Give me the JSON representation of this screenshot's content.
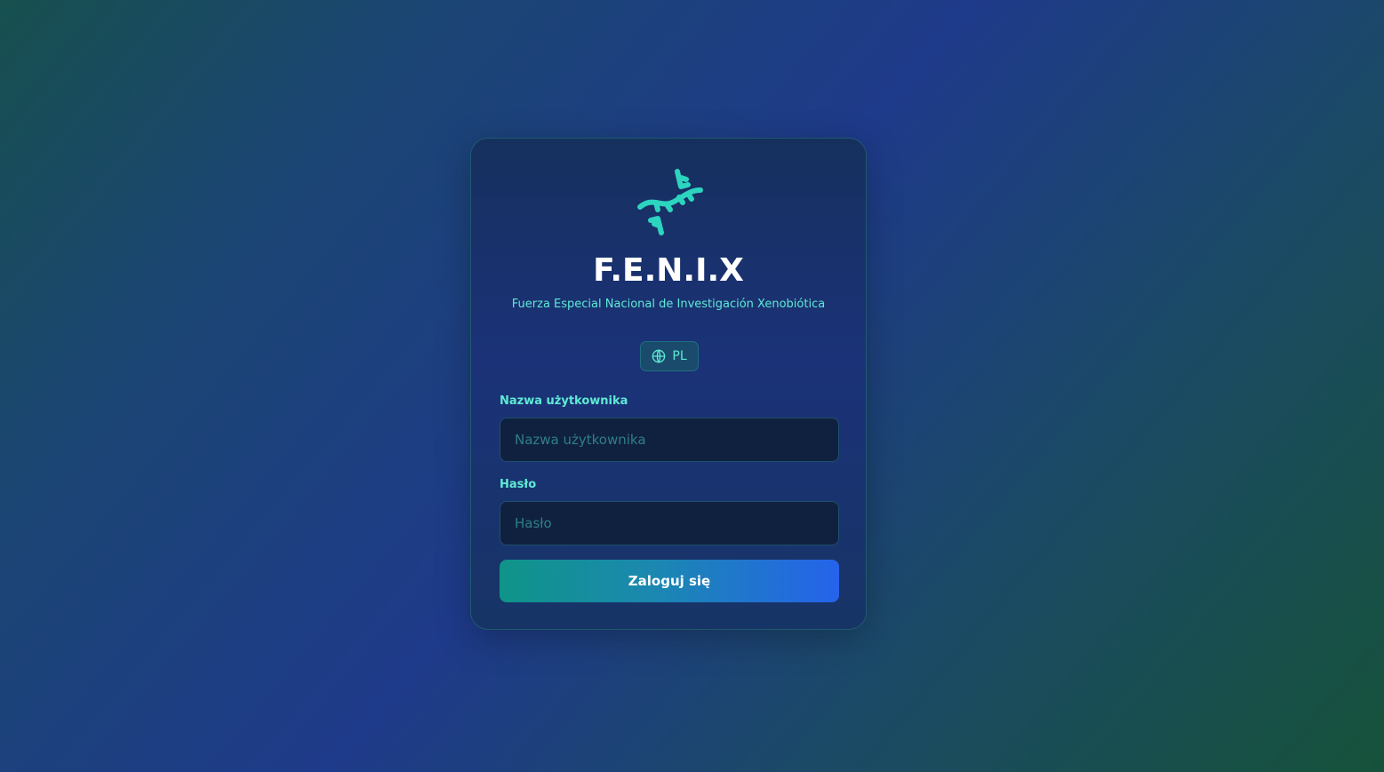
{
  "app": {
    "title": "F.E.N.I.X",
    "subtitle": "Fuerza Especial Nacional de Investigación Xenobiótica",
    "logo_icon": "dna-icon",
    "accent_color": "#2dd4bf"
  },
  "language": {
    "icon": "globe-icon",
    "label": "PL"
  },
  "form": {
    "username_label": "Nazwa użytkownika",
    "username_placeholder": "Nazwa użytkownika",
    "username_value": "",
    "password_label": "Hasło",
    "password_placeholder": "Hasło",
    "password_value": "",
    "submit_label": "Zaloguj się"
  }
}
